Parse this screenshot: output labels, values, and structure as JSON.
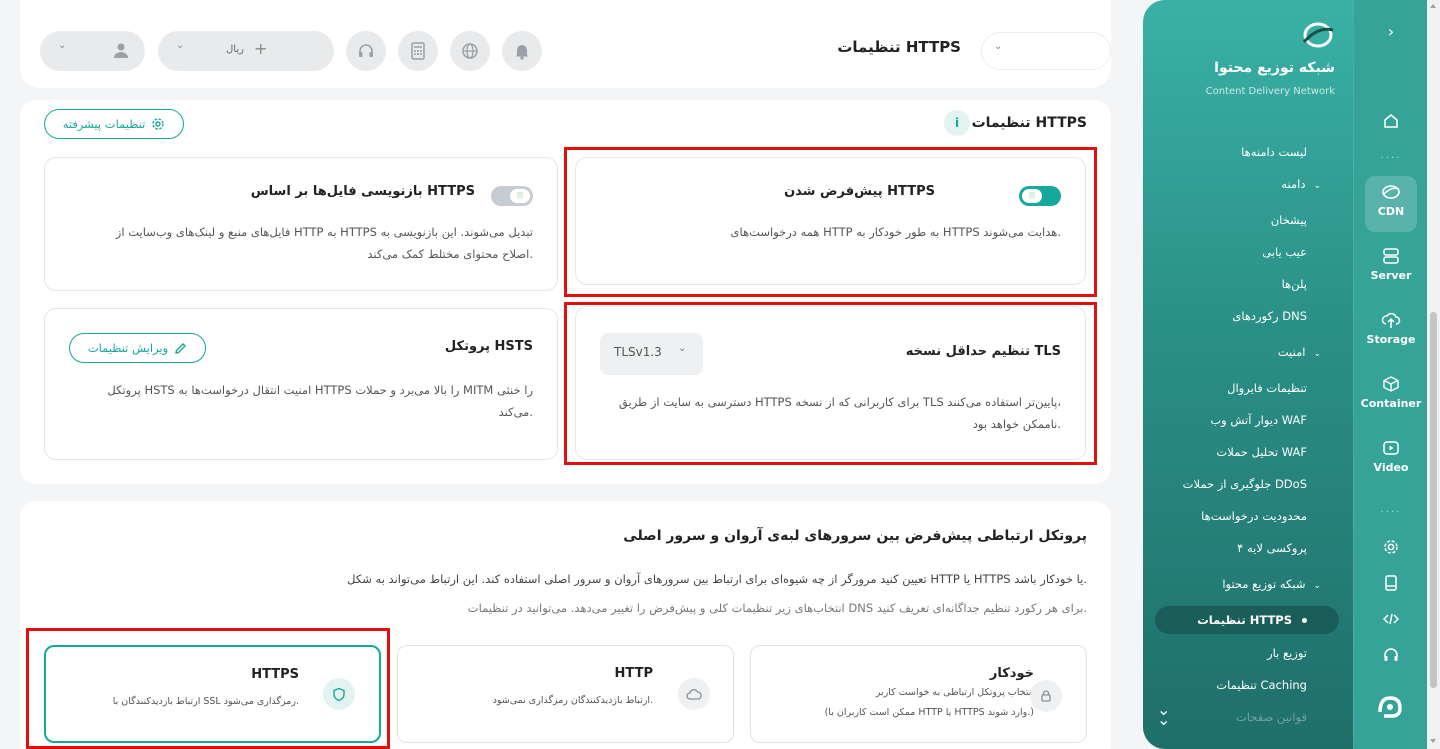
{
  "header": {
    "page_title": "تنظیمات HTTPS",
    "currency_label": "ریال",
    "currency_add_icon": "plus-icon",
    "icons": [
      "bell-icon",
      "globe-icon",
      "calculator-icon",
      "headset-icon",
      "user-icon"
    ]
  },
  "sidebar": {
    "brand_title": "شبکه توزیع محتوا",
    "brand_subtitle": "Content Delivery Network",
    "rail": [
      {
        "label": "",
        "icon": "home-icon"
      },
      {
        "label": "CDN",
        "icon": "cdn-icon"
      },
      {
        "label": "Server",
        "icon": "server-icon"
      },
      {
        "label": "Storage",
        "icon": "cloud-upload-icon"
      },
      {
        "label": "Container",
        "icon": "cube-icon"
      },
      {
        "label": "Video",
        "icon": "video-icon"
      }
    ],
    "rail_dots": "....",
    "menu": {
      "domain_list": "لیست دامنه‌ها",
      "domain_group": "دامنه",
      "dashboard": "پیشخان",
      "troubleshoot": "عیب یابی",
      "plans": "پلن‌ها",
      "dns_records": "رکوردهای DNS",
      "security_group": "امنیت",
      "firewall": "تنظیمات فایروال",
      "waf": "دیوار آتش وب WAF",
      "waf_analysis": "تحلیل حملات WAF",
      "ddos": "جلوگیری از حملات DDoS",
      "rate_limit": "محدودیت درخواست‌ها",
      "layer4": "پروکسی لایه ۴",
      "cdn_group": "شبکه توزیع محتوا",
      "https_settings": "تنظیمات HTTPS",
      "load_balance": "توزیع بار",
      "caching": "تنظیمات Caching",
      "page_rules": "قوانین صفحات"
    }
  },
  "https_section": {
    "title": "تنظیمات HTTPS",
    "info_icon": "i",
    "advanced_button": "تنظیمات پیشرفته",
    "cards": {
      "default_https": {
        "title": "پیش‌فرض شدن HTTPS",
        "desc": "همه درخواست‌های HTTP به طور خودکار به HTTPS هدایت می‌شوند.",
        "enabled": true
      },
      "rewrite": {
        "title": "بازنویسی فایل‌ها بر اساس HTTPS",
        "desc_line1": "فایل‌های منبع و لینک‌های وب‌سایت از HTTP به HTTPS تبدیل می‌شوند. این بازنویسی به",
        "desc_line2": "اصلاح محتوای مختلط کمک می‌کند.",
        "enabled": false
      },
      "tls": {
        "title": "تنظیم حداقل نسخه TLS",
        "select_value": "TLSv1.3",
        "desc_line1": "دسترسی به سایت از طریق HTTPS برای کاربرانی که از نسخه TLS پایین‌تر استفاده می‌کنند،",
        "desc_line2": "ناممکن خواهد بود."
      },
      "hsts": {
        "title": "پروتکل HSTS",
        "edit_button": "ویرایش تنظیمات",
        "desc_line1": "پروتکل HSTS امنیت انتقال درخواست‌ها به HTTPS را بالا می‌برد و حملات MITM را خنثی",
        "desc_line2": "می‌کند."
      }
    }
  },
  "protocol_section": {
    "title": "پروتکل ارتباطی پیش‌فرض بین سرورهای لبه‌ی آروان و سرور اصلی",
    "desc": "تعیین کنید مرورگر از چه شیوه‌ای برای ارتباط بین سرورهای آروان و سرور اصلی استفاده کند. این ارتباط می‌تواند به شکل HTTP یا HTTPS یا خودکار باشد.",
    "note": "انتخاب‌های زیر تنظیمات کلی و پیش‌فرض را تغییر می‌دهد. می‌توانید در تنظیمات DNS برای هر رکورد تنظیم جداگانه‌ای تعریف کنید.",
    "options": [
      {
        "title": "خودکار",
        "desc_line1": "انتخاب پروتکل ارتباطی به خواست کاربر",
        "desc_line2": "(ممکن است کاربران با HTTP یا HTTPS وارد شوند.)",
        "icon": "lock-icon",
        "selected": false
      },
      {
        "title": "HTTP",
        "desc_line1": "ارتباط بازدیدکنندگان رمزگذاری نمی‌شود.",
        "desc_line2": "",
        "icon": "cloud-icon",
        "selected": false
      },
      {
        "title": "HTTPS",
        "desc_line1": "ارتباط بازدیدکنندگان با SSL رمزگذاری می‌شود.",
        "desc_line2": "",
        "icon": "shield-icon",
        "selected": true
      }
    ]
  },
  "colors": {
    "accent": "#16a89b",
    "sidebar": "#2f9d92",
    "highlight": "#e01010"
  }
}
